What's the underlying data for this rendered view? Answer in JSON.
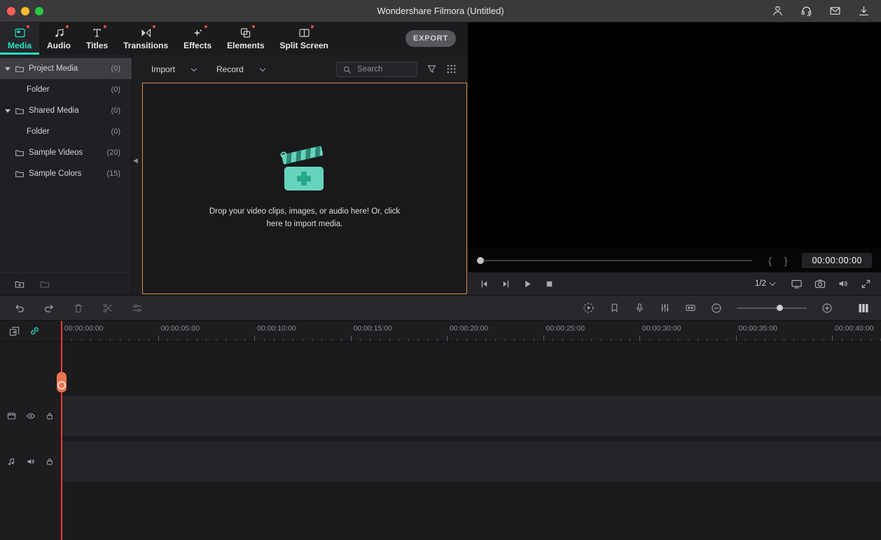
{
  "titlebar": {
    "title": "Wondershare Filmora (Untitled)"
  },
  "tabs": [
    {
      "label": "Media"
    },
    {
      "label": "Audio"
    },
    {
      "label": "Titles"
    },
    {
      "label": "Transitions"
    },
    {
      "label": "Effects"
    },
    {
      "label": "Elements"
    },
    {
      "label": "Split Screen"
    }
  ],
  "toolbar_top": {
    "export_label": "EXPORT"
  },
  "sidebar": {
    "items": [
      {
        "label": "Project Media",
        "count": "(0)"
      },
      {
        "label": "Folder",
        "count": "(0)"
      },
      {
        "label": "Shared Media",
        "count": "(0)"
      },
      {
        "label": "Folder",
        "count": "(0)"
      },
      {
        "label": "Sample Videos",
        "count": "(20)"
      },
      {
        "label": "Sample Colors",
        "count": "(15)"
      }
    ]
  },
  "media_panel": {
    "import_label": "Import",
    "record_label": "Record",
    "search_placeholder": "Search",
    "dropzone_line1": "Drop your video clips, images, or audio here! Or, click",
    "dropzone_line2": "here to import media."
  },
  "preview": {
    "timecode": "00:00:00:00",
    "playback_quality": "1/2"
  },
  "timeline": {
    "ruler_labels": [
      "00:00:00:00",
      "00:00:05:00",
      "00:00:10:00",
      "00:00:15:00",
      "00:00:20:00",
      "00:00:25:00",
      "00:00:30:00",
      "00:00:35:00",
      "00:00:40:00"
    ]
  },
  "icons": {
    "mark_in": "{",
    "mark_out": "}",
    "collapse_arrow": "◀"
  },
  "colors": {
    "accent_teal": "#27e2c3",
    "dropzone_border": "#d98e3f",
    "playhead_line": "#ee3a30",
    "playhead_handle": "#ee7350",
    "tab_badge": "#e54b3c"
  }
}
